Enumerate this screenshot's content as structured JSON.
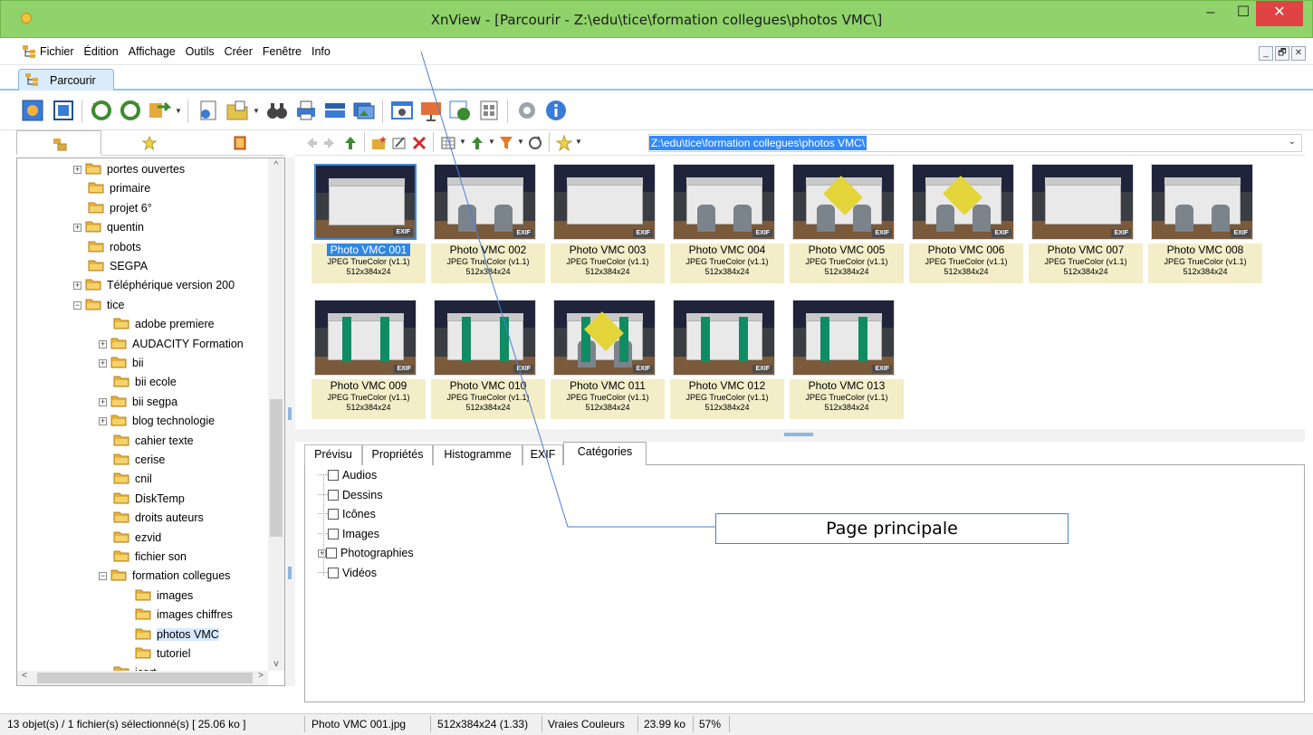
{
  "window": {
    "title": "XnView - [Parcourir - Z:\\edu\\tice\\formation collegues\\photos VMC\\]",
    "min_glyph": "–",
    "max_glyph": "☐",
    "close_glyph": "✕"
  },
  "menubar": {
    "items": [
      "Fichier",
      "Édition",
      "Affichage",
      "Outils",
      "Créer",
      "Fenêtre",
      "Info"
    ],
    "mdi": [
      "_",
      "🗗",
      "✕"
    ]
  },
  "tab": {
    "label": "Parcourir"
  },
  "address": {
    "value": "Z:\\edu\\tice\\formation collegues\\photos VMC\\",
    "dropdown_glyph": "⌄"
  },
  "tree": {
    "nodes": [
      {
        "label": "portes ouvertes",
        "level": 0,
        "expander": "+"
      },
      {
        "label": "primaire",
        "level": 0,
        "expander": ""
      },
      {
        "label": "projet 6°",
        "level": 0,
        "expander": ""
      },
      {
        "label": "quentin",
        "level": 0,
        "expander": "+"
      },
      {
        "label": "robots",
        "level": 0,
        "expander": ""
      },
      {
        "label": "SEGPA",
        "level": 0,
        "expander": ""
      },
      {
        "label": "Téléphérique version 200",
        "level": 0,
        "expander": "+"
      },
      {
        "label": "tice",
        "level": 0,
        "expander": "−"
      },
      {
        "label": "adobe premiere",
        "level": 1,
        "expander": ""
      },
      {
        "label": "AUDACITY Formation",
        "level": 1,
        "expander": "+"
      },
      {
        "label": "bii",
        "level": 1,
        "expander": "+"
      },
      {
        "label": "bii ecole",
        "level": 1,
        "expander": ""
      },
      {
        "label": "bii segpa",
        "level": 1,
        "expander": "+"
      },
      {
        "label": "blog technologie",
        "level": 1,
        "expander": "+"
      },
      {
        "label": "cahier texte",
        "level": 1,
        "expander": ""
      },
      {
        "label": "cerise",
        "level": 1,
        "expander": ""
      },
      {
        "label": "cnil",
        "level": 1,
        "expander": ""
      },
      {
        "label": "DiskTemp",
        "level": 1,
        "expander": ""
      },
      {
        "label": "droits auteurs",
        "level": 1,
        "expander": ""
      },
      {
        "label": "ezvid",
        "level": 1,
        "expander": ""
      },
      {
        "label": "fichier son",
        "level": 1,
        "expander": ""
      },
      {
        "label": "formation collegues",
        "level": 1,
        "expander": "−"
      },
      {
        "label": "images",
        "level": 2,
        "expander": ""
      },
      {
        "label": "images chiffres",
        "level": 2,
        "expander": ""
      },
      {
        "label": "photos VMC",
        "level": 2,
        "expander": "",
        "selected": true
      },
      {
        "label": "tutoriel",
        "level": 2,
        "expander": ""
      },
      {
        "label": "icart",
        "level": 1,
        "expander": ""
      }
    ],
    "scroll_up": "^",
    "scroll_down": "v",
    "scroll_left": "<",
    "scroll_right": ">"
  },
  "thumbnails": {
    "format": "JPEG TrueColor (v1.1)",
    "dims": "512x384x24",
    "badge": "EXIF",
    "items": [
      {
        "name": "Photo  VMC 001",
        "selected": true,
        "style": "plain"
      },
      {
        "name": "Photo  VMC 002",
        "style": "open"
      },
      {
        "name": "Photo  VMC 003",
        "style": "plain"
      },
      {
        "name": "Photo  VMC 004",
        "style": "pipes"
      },
      {
        "name": "Photo  VMC 005",
        "style": "yellow"
      },
      {
        "name": "Photo  VMC 006",
        "style": "yellow-open"
      },
      {
        "name": "Photo  VMC 007",
        "style": "plain"
      },
      {
        "name": "Photo  VMC 008",
        "style": "open"
      },
      {
        "name": "Photo  VMC 009",
        "style": "tape"
      },
      {
        "name": "Photo  VMC 010",
        "style": "tape"
      },
      {
        "name": "Photo  VMC 011",
        "style": "tape-yellow"
      },
      {
        "name": "Photo  VMC 012",
        "style": "tape"
      },
      {
        "name": "Photo  VMC 013",
        "style": "tape"
      }
    ]
  },
  "preview_tabs": [
    "Prévisu",
    "Propriétés",
    "Histogramme",
    "EXIF",
    "Catégories"
  ],
  "active_preview_tab": 4,
  "categories": [
    {
      "label": "Audios",
      "expander": ""
    },
    {
      "label": "Dessins",
      "expander": ""
    },
    {
      "label": "Icônes",
      "expander": ""
    },
    {
      "label": "Images",
      "expander": ""
    },
    {
      "label": "Photographies",
      "expander": "+"
    },
    {
      "label": "Vidéos",
      "expander": ""
    }
  ],
  "annotation": {
    "label": "Page principale"
  },
  "status": {
    "count": "13 objet(s) / 1 fichier(s) sélectionné(s)  [ 25.06 ko ]",
    "file": "Photo  VMC 001.jpg",
    "dims": "512x384x24 (1.33)",
    "color": "Vraies Couleurs",
    "size": "23.99 ko",
    "zoom": "57%"
  },
  "colors": {
    "titlebar": "#8fd36a",
    "selection": "#3389ff",
    "caption_bg": "#f3eec8",
    "close": "#e04343"
  }
}
